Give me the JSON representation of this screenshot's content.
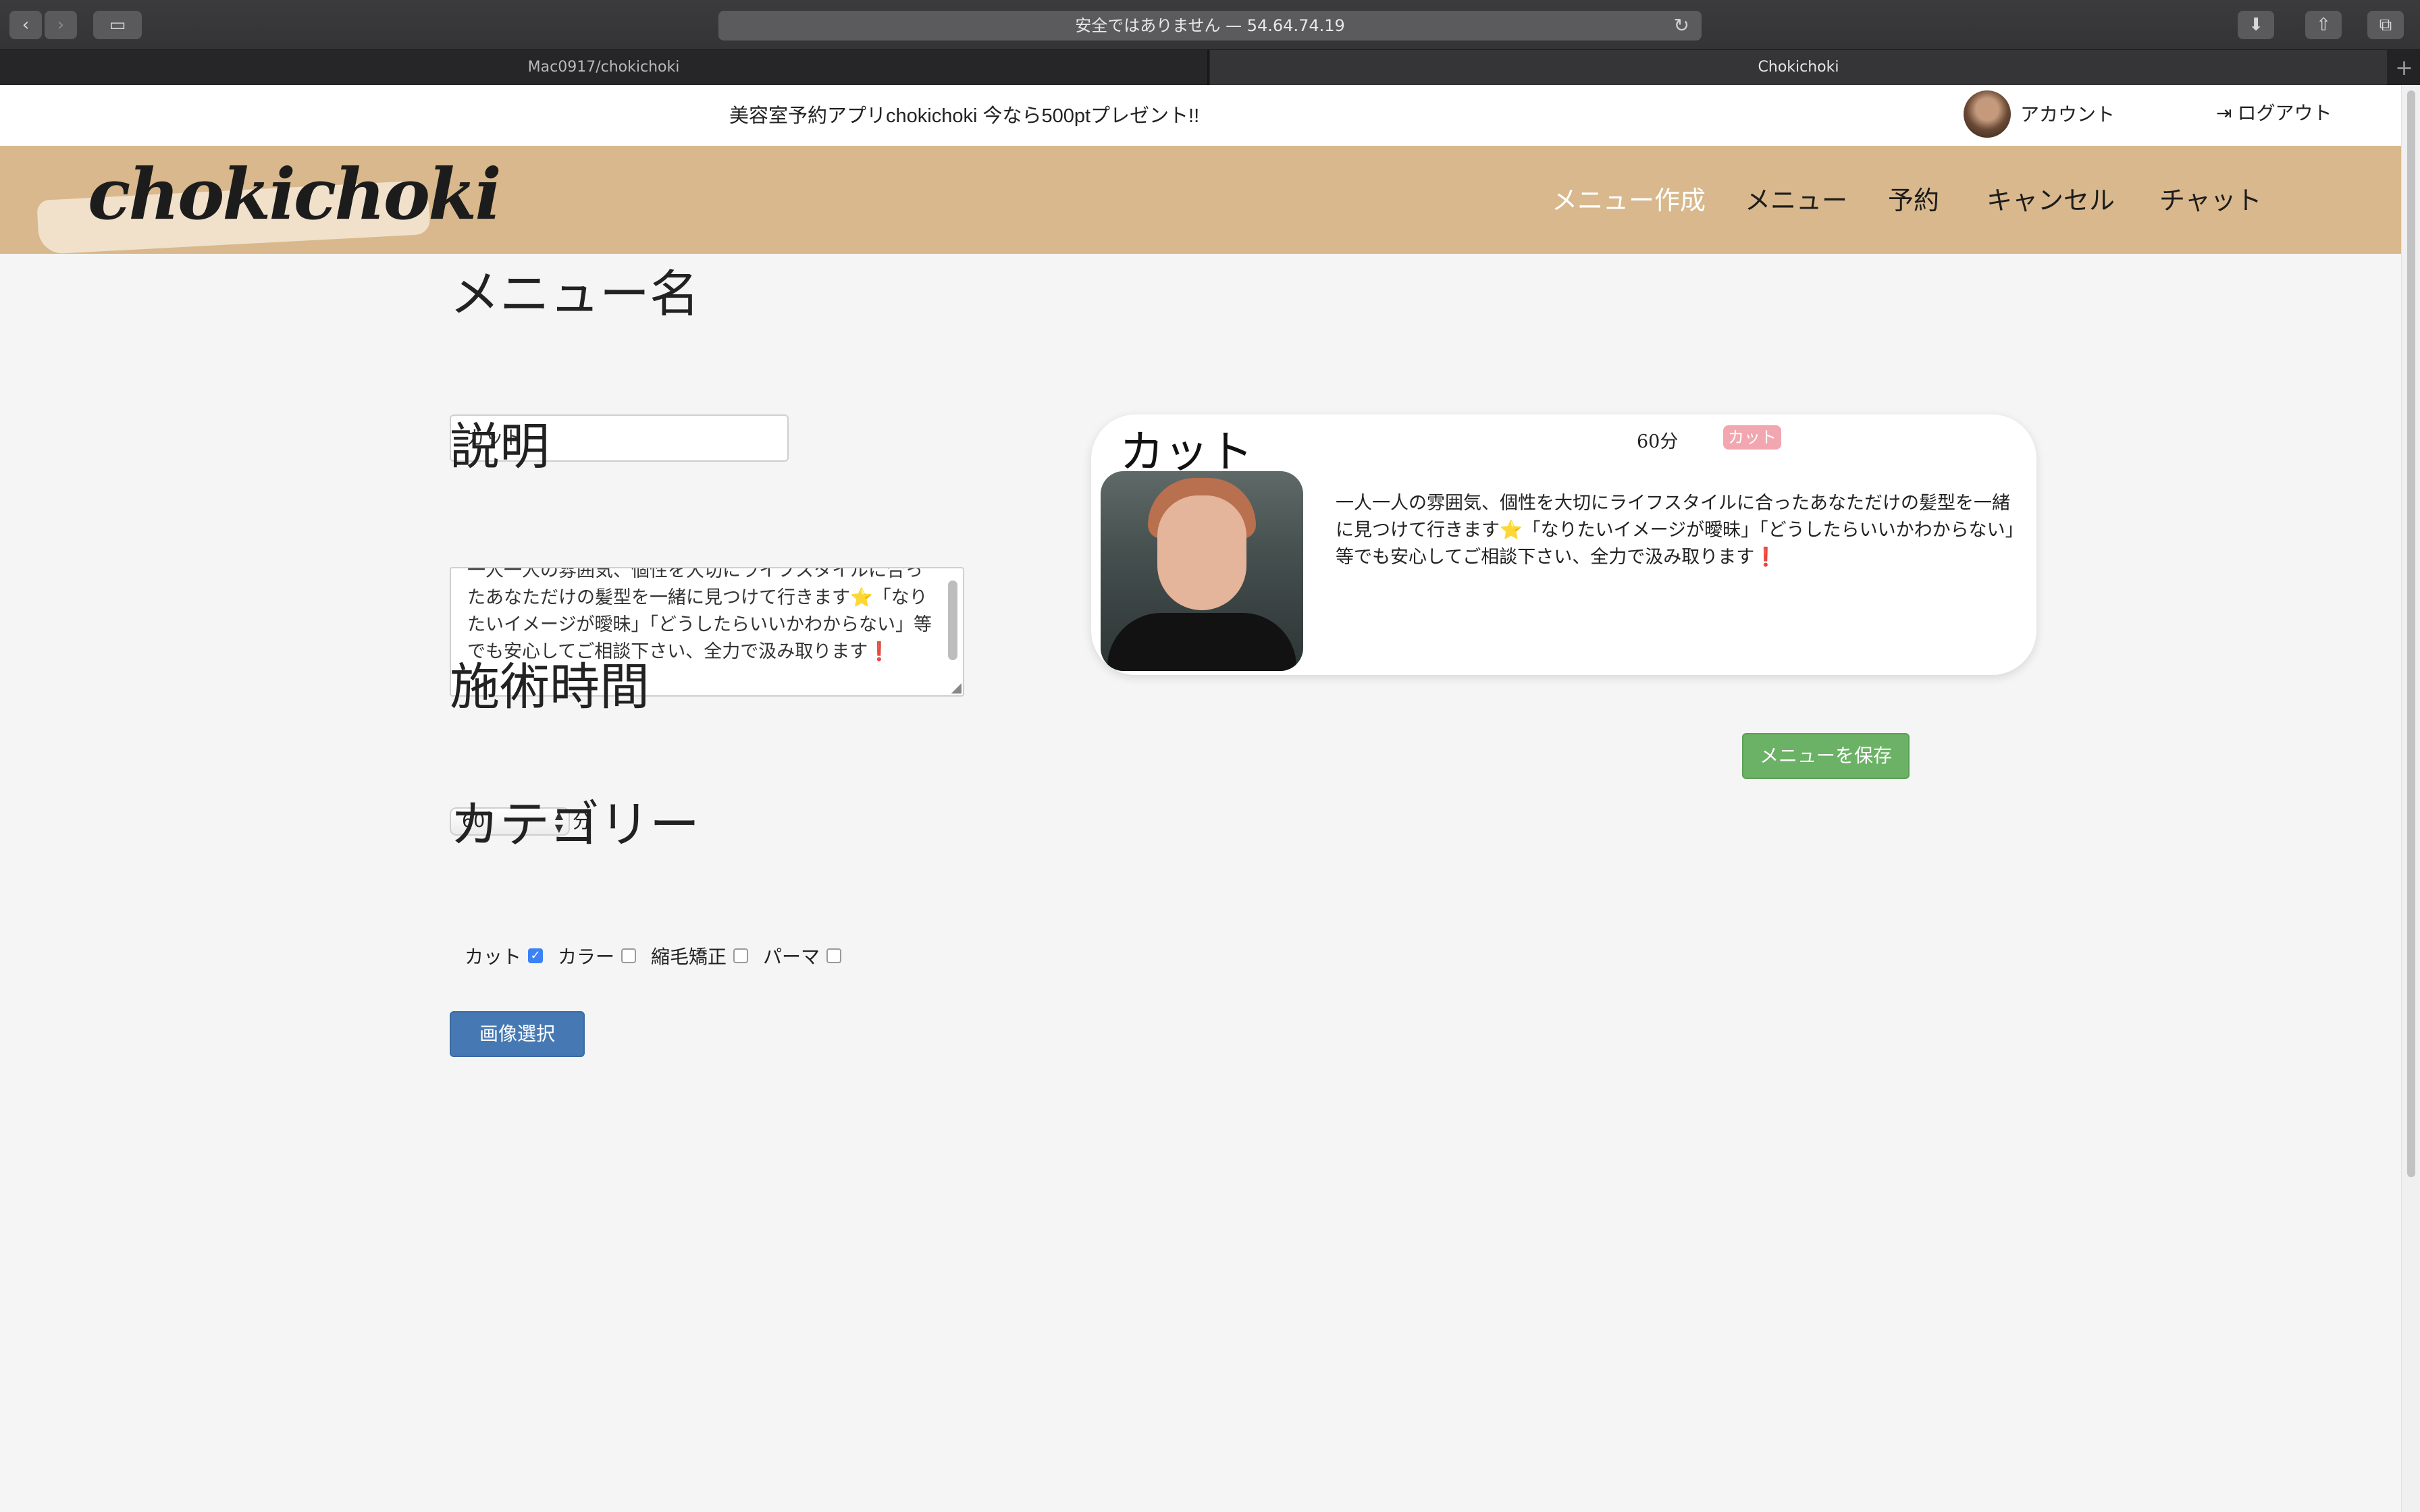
{
  "browser": {
    "url": "安全ではありません — 54.64.74.19",
    "tabs": [
      {
        "label": "Mac0917/chokichoki",
        "active": false
      },
      {
        "label": "Chokichoki",
        "active": true
      }
    ]
  },
  "topbar": {
    "announcement": "美容室予約アプリchokichoki 今なら500ptプレゼント!!",
    "account_label": "アカウント",
    "logout_label": "ログアウト"
  },
  "navbar": {
    "logo": "chokichoki",
    "items": [
      "メニュー作成",
      "メニュー",
      "予約",
      "キャンセル",
      "チャット"
    ],
    "active_index": 0
  },
  "form": {
    "name_heading": "メニュー名",
    "name_value": "カット",
    "desc_heading": "説明",
    "desc_value": "一人一人の雰囲気、個性を大切にライフスタイルに合ったあなただけの髪型を一緒に見つけて行きます⭐️「なりたいイメージが曖昧」「どうしたらいいかわからない」等でも安心してご相談下さい、全力で汲み取ります❗",
    "time_heading": "施術時間",
    "time_value": "60",
    "time_unit": "分",
    "category_heading": "カテゴリー",
    "categories": [
      {
        "label": "カット",
        "checked": true
      },
      {
        "label": "カラー",
        "checked": false
      },
      {
        "label": "縮毛矯正",
        "checked": false
      },
      {
        "label": "パーマ",
        "checked": false
      }
    ],
    "image_button": "画像選択"
  },
  "preview": {
    "title": "カット",
    "time": "60分",
    "badge": "カット",
    "description": "一人一人の雰囲気、個性を大切にライフスタイルに合ったあなただけの髪型を一緒に見つけて行きます⭐️「なりたいイメージが曖昧」「どうしたらいいかわからない」等でも安心してご相談下さい、全力で汲み取ります❗"
  },
  "save_button": "メニューを保存",
  "colors": {
    "nav_bg": "#d8b88c",
    "save_btn": "#6bb166",
    "image_btn": "#4679b3",
    "badge": "#f2a7b0"
  }
}
